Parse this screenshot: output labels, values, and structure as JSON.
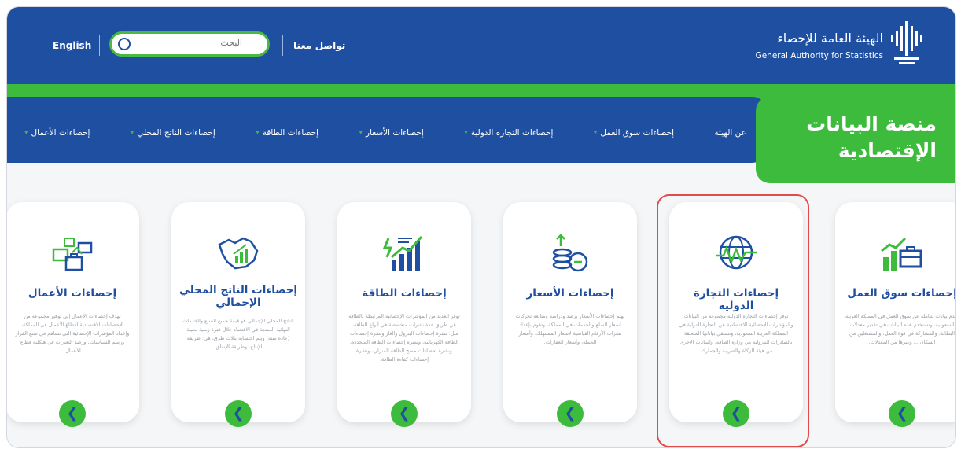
{
  "header": {
    "logo_arabic": "الهيئة العامة للإحصاء",
    "logo_english": "General Authority for Statistics",
    "language_link": "English",
    "search_placeholder": "البحث",
    "contact_link": "تواصل معنا",
    "brand_blue": "#1f4fa0",
    "brand_green": "#3dbb3c"
  },
  "platform": {
    "title_line1": "منصة البيانات",
    "title_line2": "الإقتصادية"
  },
  "nav": {
    "items": [
      {
        "label": "عن الهيئة",
        "dropdown": false
      },
      {
        "label": "إحصاءات سوق العمل",
        "dropdown": true
      },
      {
        "label": "إحصاءات التجارة الدولية",
        "dropdown": true
      },
      {
        "label": "إحصاءات الأسعار",
        "dropdown": true
      },
      {
        "label": "إحصاءات الطاقة",
        "dropdown": true
      },
      {
        "label": "إحصاءات الناتج المحلي",
        "dropdown": true
      },
      {
        "label": "إحصاءات الأعمال",
        "dropdown": true
      }
    ]
  },
  "cards": [
    {
      "title": "إحصاءات سوق العمل",
      "icon": "labor-market-icon",
      "desc": "تقدم بيانات شاملة عن سوق العمل في المملكة العربية السعودية، وتستخدم هذه البيانات في تقدير معدلات البطالة، والمشاركة في قوة العمل، والمشتغلين من السكان ... وغيرها من المعدلات."
    },
    {
      "title": "إحصاءات التجارة الدولية",
      "icon": "globe-trade-icon",
      "desc": "توفر إحصاءات التجارة الدولية مجموعة من البيانات والمؤشرات الإحصائية الاقتصادية عن التجارة الدولية في المملكة العربية السعودية، وتستقي بياناتها المتعلقة بالصادرات البترولية من وزارة الطاقة، والبيانات الأخرى من هيئة الزكاة والضريبة والجمارك."
    },
    {
      "title": "إحصاءات الأسعار",
      "icon": "prices-coins-icon",
      "desc": "تهتم إحصاءات الأسعار برصد ودراسة ومتابعة تحركات أسعار السلع والخدمات في المملكة، وتقوم بإعداد نشرات الأرقام القياسية لأسعار المستهلك، وأسعار الجملة، وأسعار العقارات."
    },
    {
      "title": "إحصاءات الطاقة",
      "icon": "energy-chart-icon",
      "desc": "توفر العديد من المؤشرات الإحصائية المرتبطة بالطاقة عن طريق عدة نشرات متخصصة في أنواع الطاقة، مثل: نشرة إحصاءات البترول والغاز ونشرة إحصاءات الطاقة الكهربائية، ونشرة إحصاءات الطاقة المتجددة، ونشرة إحصاءات مسح الطاقة المنزلي، ونشرة إحصاءات كفاءة الطاقة."
    },
    {
      "title": "إحصاءات الناتج المحلي الإجمالي",
      "icon": "gdp-map-icon",
      "desc": "الناتج المحلي الإجمالي هو قيمة جميع السلع والخدمات النهائية المنتجة في الاقتصاد خلال فترة زمنية معينة (عادة سنة) ويتم احتسابه بثلاث طرق، هي: طريقة الإنتاج، وطريقة الإنفاق."
    },
    {
      "title": "إحصاءات الأعمال",
      "icon": "business-briefcase-icon",
      "desc": "تهدف إحصاءات الأعمال إلى توفير مجموعة من الإحصاءات الاقتصادية لقطاع الأعمال في المملكة، وإعداد المؤشرات الإحصائية التي تساهم في صنع القرار ورسم السياسات، ورصد التغيرات في هيكلية قطاع الأعمال."
    }
  ]
}
